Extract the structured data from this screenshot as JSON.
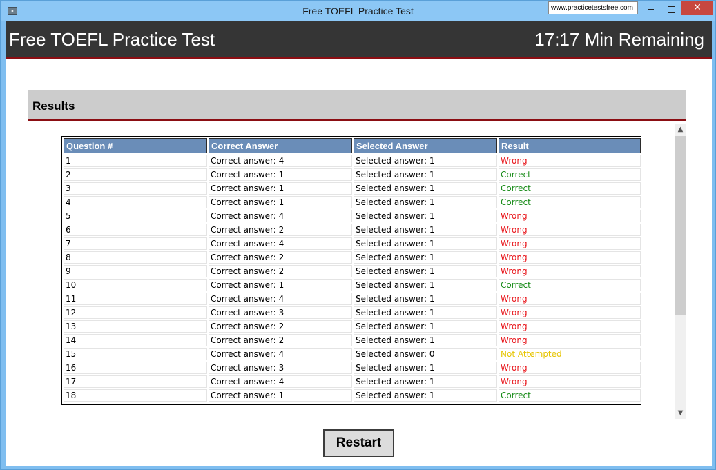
{
  "window": {
    "title": "Free TOEFL Practice Test",
    "url_badge": "www.practicetestsfree.com",
    "icon_name": "app-icon",
    "close_label": "✕"
  },
  "header": {
    "title": "Free TOEFL Practice Test",
    "timer": "17:17 Min Remaining"
  },
  "results": {
    "label": "Results",
    "columns": [
      "Question #",
      "Correct Answer",
      "Selected Answer",
      "Result"
    ],
    "rows": [
      {
        "q": "1",
        "correct": "Correct answer: 4",
        "selected": "Selected answer: 1",
        "result": "Wrong",
        "status": "wrong"
      },
      {
        "q": "2",
        "correct": "Correct answer: 1",
        "selected": "Selected answer: 1",
        "result": "Correct",
        "status": "correct"
      },
      {
        "q": "3",
        "correct": "Correct answer: 1",
        "selected": "Selected answer: 1",
        "result": "Correct",
        "status": "correct"
      },
      {
        "q": "4",
        "correct": "Correct answer: 1",
        "selected": "Selected answer: 1",
        "result": "Correct",
        "status": "correct"
      },
      {
        "q": "5",
        "correct": "Correct answer: 4",
        "selected": "Selected answer: 1",
        "result": "Wrong",
        "status": "wrong"
      },
      {
        "q": "6",
        "correct": "Correct answer: 2",
        "selected": "Selected answer: 1",
        "result": "Wrong",
        "status": "wrong"
      },
      {
        "q": "7",
        "correct": "Correct answer: 4",
        "selected": "Selected answer: 1",
        "result": "Wrong",
        "status": "wrong"
      },
      {
        "q": "8",
        "correct": "Correct answer: 2",
        "selected": "Selected answer: 1",
        "result": "Wrong",
        "status": "wrong"
      },
      {
        "q": "9",
        "correct": "Correct answer: 2",
        "selected": "Selected answer: 1",
        "result": "Wrong",
        "status": "wrong"
      },
      {
        "q": "10",
        "correct": "Correct answer: 1",
        "selected": "Selected answer: 1",
        "result": "Correct",
        "status": "correct"
      },
      {
        "q": "11",
        "correct": "Correct answer: 4",
        "selected": "Selected answer: 1",
        "result": "Wrong",
        "status": "wrong"
      },
      {
        "q": "12",
        "correct": "Correct answer: 3",
        "selected": "Selected answer: 1",
        "result": "Wrong",
        "status": "wrong"
      },
      {
        "q": "13",
        "correct": "Correct answer: 2",
        "selected": "Selected answer: 1",
        "result": "Wrong",
        "status": "wrong"
      },
      {
        "q": "14",
        "correct": "Correct answer: 2",
        "selected": "Selected answer: 1",
        "result": "Wrong",
        "status": "wrong"
      },
      {
        "q": "15",
        "correct": "Correct answer: 4",
        "selected": "Selected answer: 0",
        "result": "Not Attempted",
        "status": "na"
      },
      {
        "q": "16",
        "correct": "Correct answer: 3",
        "selected": "Selected answer: 1",
        "result": "Wrong",
        "status": "wrong"
      },
      {
        "q": "17",
        "correct": "Correct answer: 4",
        "selected": "Selected answer: 1",
        "result": "Wrong",
        "status": "wrong"
      },
      {
        "q": "18",
        "correct": "Correct answer: 1",
        "selected": "Selected answer: 1",
        "result": "Correct",
        "status": "correct"
      }
    ]
  },
  "actions": {
    "restart_label": "Restart"
  },
  "colors": {
    "header_bg": "#353535",
    "accent_red": "#8b0e13",
    "table_header_bg": "#6a8db8",
    "wrong": "#e8161b",
    "correct": "#1a8c1a",
    "not_attempted": "#e6c400"
  }
}
